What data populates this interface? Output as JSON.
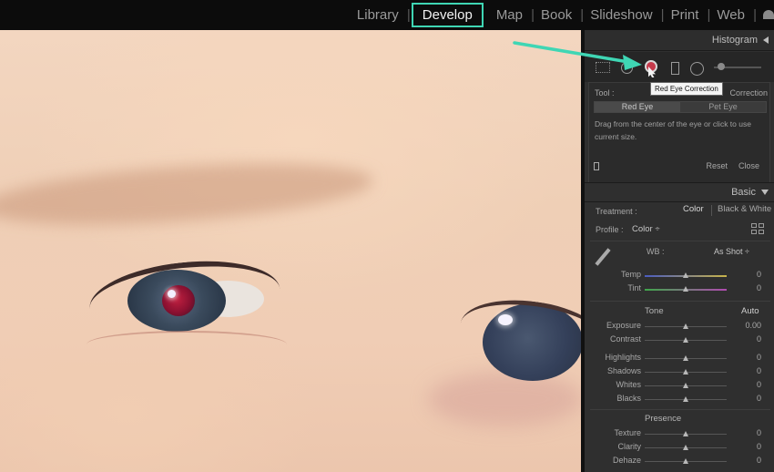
{
  "modules": {
    "items": [
      {
        "label": "Library",
        "active": false
      },
      {
        "label": "Develop",
        "active": true
      },
      {
        "label": "Map",
        "active": false
      },
      {
        "label": "Book",
        "active": false
      },
      {
        "label": "Slideshow",
        "active": false
      },
      {
        "label": "Print",
        "active": false
      },
      {
        "label": "Web",
        "active": false
      }
    ],
    "highlight_color": "#3fd6b4"
  },
  "panel": {
    "histogram_title": "Histogram",
    "tooltip": "Red Eye Correction",
    "tool_label": "Tool :",
    "tool_name": "Correction",
    "segments": [
      {
        "label": "Red Eye",
        "selected": true
      },
      {
        "label": "Pet Eye",
        "selected": false
      }
    ],
    "help_text": "Drag from the center of the eye or click to use current size.",
    "reset_label": "Reset",
    "close_label": "Close",
    "basic_title": "Basic",
    "treatment_label": "Treatment :",
    "treatment_color": "Color",
    "treatment_bw": "Black & White",
    "profile_label": "Profile :",
    "profile_value": "Color ÷",
    "wb_label": "WB :",
    "wb_value": "As Shot ÷",
    "tone_label": "Tone",
    "auto_label": "Auto",
    "presence_label": "Presence",
    "sliders": {
      "temp": {
        "label": "Temp",
        "value": "0",
        "pos": 0.5
      },
      "tint": {
        "label": "Tint",
        "value": "0",
        "pos": 0.5
      },
      "exposure": {
        "label": "Exposure",
        "value": "0.00",
        "pos": 0.5
      },
      "contrast": {
        "label": "Contrast",
        "value": "0",
        "pos": 0.5
      },
      "highlights": {
        "label": "Highlights",
        "value": "0",
        "pos": 0.5
      },
      "shadows": {
        "label": "Shadows",
        "value": "0",
        "pos": 0.5
      },
      "whites": {
        "label": "Whites",
        "value": "0",
        "pos": 0.5
      },
      "blacks": {
        "label": "Blacks",
        "value": "0",
        "pos": 0.5
      },
      "texture": {
        "label": "Texture",
        "value": "0",
        "pos": 0.5
      },
      "clarity": {
        "label": "Clarity",
        "value": "0",
        "pos": 0.5
      },
      "dehaze": {
        "label": "Dehaze",
        "value": "0",
        "pos": 0.5
      }
    }
  }
}
